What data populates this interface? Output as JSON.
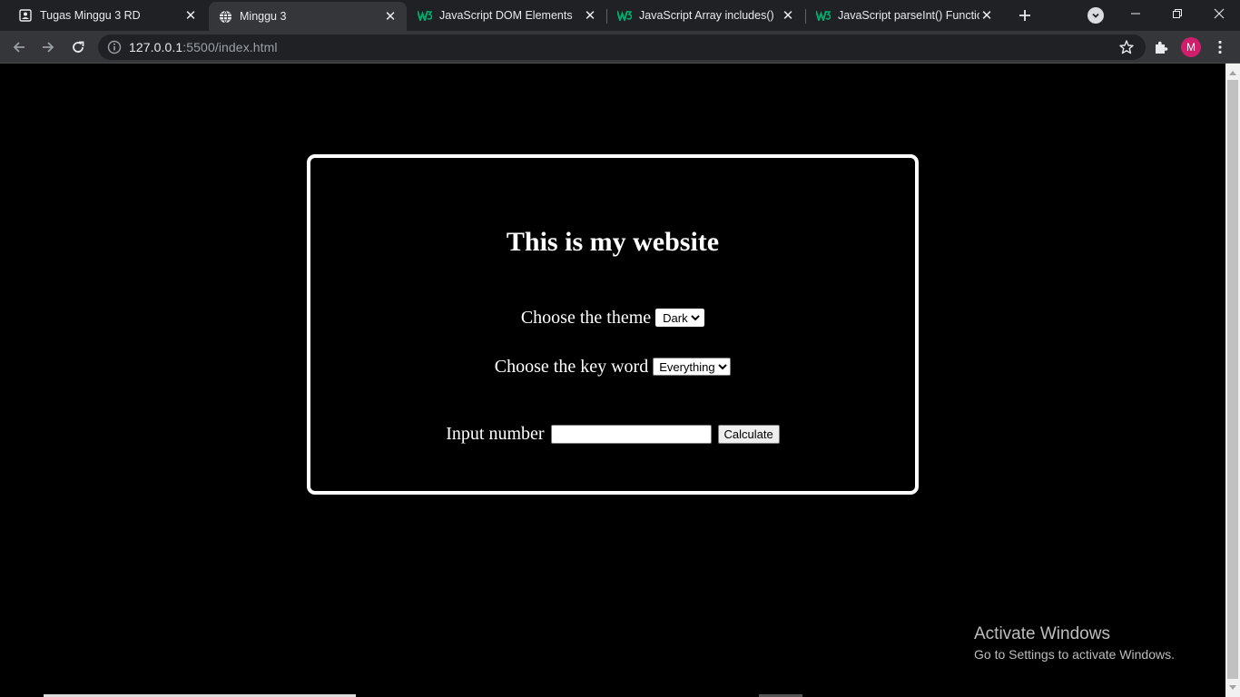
{
  "tabs": [
    {
      "title": "Tugas Minggu 3 RD",
      "icon": "portrait-icon",
      "active": false
    },
    {
      "title": "Minggu 3",
      "icon": "globe-icon",
      "active": true
    },
    {
      "title": "JavaScript DOM Elements",
      "icon": "w3schools-icon",
      "active": false
    },
    {
      "title": "JavaScript Array includes() Me",
      "icon": "w3schools-icon",
      "active": false
    },
    {
      "title": "JavaScript parseInt() Function",
      "icon": "w3schools-icon",
      "active": false
    }
  ],
  "address_bar": {
    "host": "127.0.0.1",
    "rest": ":5500/index.html"
  },
  "profile": {
    "initial": "M",
    "color": "#d01f6a"
  },
  "page": {
    "heading": "This is my website",
    "theme_label": "Choose the theme",
    "theme_selected": "Dark",
    "keyword_label": "Choose the key word",
    "keyword_selected": "Everything",
    "number_label": "Input number",
    "number_value": "",
    "calculate_label": "Calculate"
  },
  "watermark": {
    "line1": "Activate Windows",
    "line2": "Go to Settings to activate Windows."
  },
  "colors": {
    "page_bg": "#000000",
    "card_border": "#ffffff",
    "chrome_dark": "#202124",
    "chrome_toolbar": "#35363a",
    "w3_green": "#04aa6d"
  }
}
